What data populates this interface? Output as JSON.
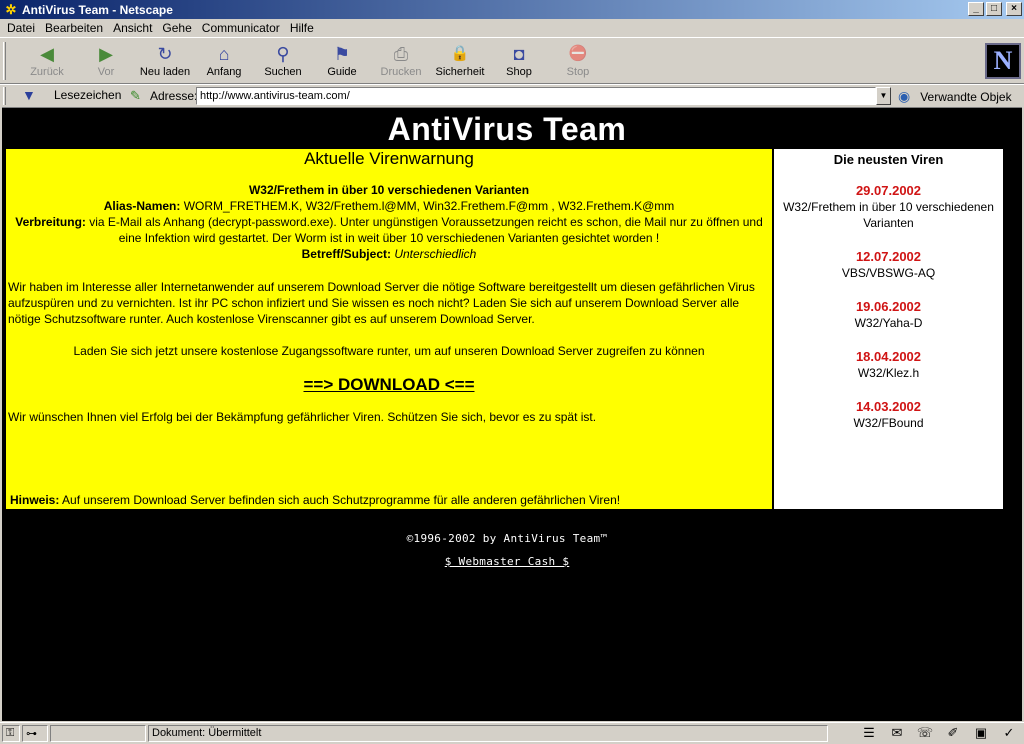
{
  "window": {
    "title": "AntiVirus Team - Netscape",
    "buttons": {
      "minimize": "_",
      "maximize": "□",
      "close": "×"
    }
  },
  "menu": [
    "Datei",
    "Bearbeiten",
    "Ansicht",
    "Gehe",
    "Communicator",
    "Hilfe"
  ],
  "toolbar": {
    "buttons": [
      {
        "label": "Zurück",
        "icon": "back-arrow-icon",
        "glyph": "◀",
        "enabled": false
      },
      {
        "label": "Vor",
        "icon": "forward-arrow-icon",
        "glyph": "▶",
        "enabled": false
      },
      {
        "label": "Neu laden",
        "icon": "reload-icon",
        "glyph": "↻",
        "enabled": true
      },
      {
        "label": "Anfang",
        "icon": "home-icon",
        "glyph": "⌂",
        "enabled": true
      },
      {
        "label": "Suchen",
        "icon": "search-icon",
        "glyph": "⚲",
        "enabled": true
      },
      {
        "label": "Guide",
        "icon": "guide-icon",
        "glyph": "⚑",
        "enabled": true
      },
      {
        "label": "Drucken",
        "icon": "print-icon",
        "glyph": "⎙",
        "enabled": false
      },
      {
        "label": "Sicherheit",
        "icon": "lock-icon",
        "glyph": "🔒",
        "enabled": true
      },
      {
        "label": "Shop",
        "icon": "shop-bag-icon",
        "glyph": "◘",
        "enabled": true
      },
      {
        "label": "Stop",
        "icon": "stop-icon",
        "glyph": "⛔",
        "enabled": false
      }
    ],
    "logo": "N"
  },
  "location": {
    "bookmarks_label": "Lesezeichen",
    "address_label": "Adresse:",
    "url": "http://www.antivirus-team.com/",
    "related_label": "Verwandte Objek"
  },
  "page": {
    "site_title": "AntiVirus Team",
    "main": {
      "heading": "Aktuelle Virenwarnung",
      "virus_title": "W32/Frethem in über 10 verschiedenen Varianten",
      "alias_label": "Alias-Namen:",
      "alias_value": " WORM_FRETHEM.K, W32/Frethem.l@MM, Win32.Frethem.F@mm , W32.Frethem.K@mm",
      "spread_label": "Verbreitung:",
      "spread_value": " via E-Mail als Anhang (decrypt-password.exe). Unter ungünstigen Voraussetzungen reicht es schon, die Mail nur zu öffnen und eine Infektion wird gestartet. Der Worm ist in weit über 10 verschiedenen Varianten gesichtet worden !",
      "subject_label": "Betreff/Subject:",
      "subject_value": " Unterschiedlich",
      "paragraph1": "Wir haben im Interesse aller Internetanwender auf unserem Download Server die nötige Software bereitgestellt um diesen gefährlichen Virus aufzuspüren und zu vernichten. Ist ihr PC schon infiziert und Sie wissen es noch nicht? Laden Sie sich auf unserem Download Server alle nötige Schutzsoftware runter. Auch kostenlose Virenscanner gibt es auf unserem Download Server.",
      "paragraph2": "Laden Sie sich jetzt unsere kostenlose Zugangssoftware runter, um auf unseren Download Server zugreifen zu können",
      "download_link": "==> DOWNLOAD <==",
      "paragraph3": "Wir wünschen Ihnen viel Erfolg bei der Bekämpfung gefährlicher Viren. Schützen Sie sich, bevor es zu spät ist.",
      "note_label": "Hinweis:",
      "note_value": " Auf unserem Download Server befinden sich auch Schutzprogramme für alle anderen gefährlichen Viren!"
    },
    "sidebar": {
      "heading": "Die neusten Viren",
      "items": [
        {
          "date": "29.07.2002",
          "name": "W32/Frethem in über 10 verschiedenen Varianten"
        },
        {
          "date": "12.07.2002",
          "name": "VBS/VBSWG-AQ"
        },
        {
          "date": "19.06.2002",
          "name": "W32/Yaha-D"
        },
        {
          "date": "18.04.2002",
          "name": "W32/Klez.h"
        },
        {
          "date": "14.03.2002",
          "name": "W32/FBound"
        }
      ]
    },
    "footer": {
      "copyright": "©1996-2002 by AntiVirus Team™",
      "link": "$ Webmaster Cash $"
    }
  },
  "status": {
    "text": "Dokument: Übermittelt"
  },
  "colors": {
    "background": "#000000",
    "main_panel": "#ffff00",
    "date_red": "#d01414"
  }
}
